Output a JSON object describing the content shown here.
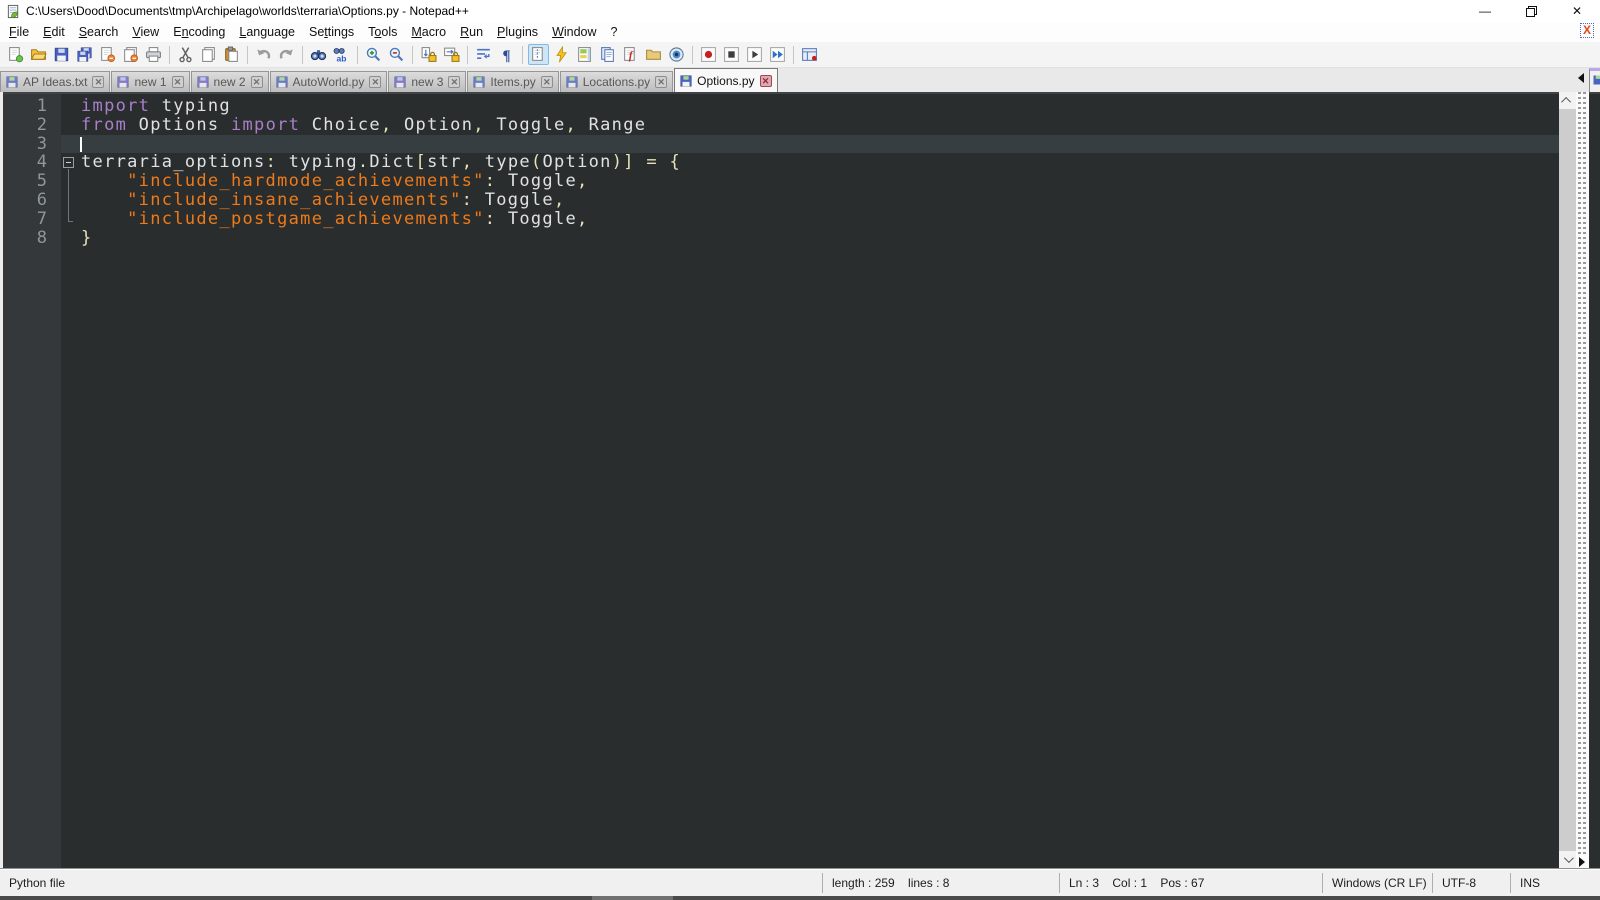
{
  "window": {
    "title": "C:\\Users\\Dood\\Documents\\tmp\\Archipelago\\worlds\\terraria\\Options.py - Notepad++",
    "controls": {
      "minimize": "—",
      "restore": "❐",
      "close": "✕"
    }
  },
  "menu": {
    "items": [
      {
        "label": "File",
        "mnemonic": 0
      },
      {
        "label": "Edit",
        "mnemonic": 0
      },
      {
        "label": "Search",
        "mnemonic": 0
      },
      {
        "label": "View",
        "mnemonic": 0
      },
      {
        "label": "Encoding",
        "mnemonic": 1
      },
      {
        "label": "Language",
        "mnemonic": 0
      },
      {
        "label": "Settings",
        "mnemonic": 2
      },
      {
        "label": "Tools",
        "mnemonic": 1
      },
      {
        "label": "Macro",
        "mnemonic": 0
      },
      {
        "label": "Run",
        "mnemonic": 0
      },
      {
        "label": "Plugins",
        "mnemonic": 0
      },
      {
        "label": "Window",
        "mnemonic": 0
      },
      {
        "label": "?",
        "mnemonic": -1
      }
    ],
    "doc_close_label": "X"
  },
  "toolbar": {
    "groups": [
      [
        "new-file",
        "open-folder",
        "save",
        "save-all",
        "close-doc",
        "close-all-docs",
        "print"
      ],
      [
        "cut",
        "copy",
        "paste"
      ],
      [
        "undo",
        "redo"
      ],
      [
        "find",
        "replace"
      ],
      [
        "zoom-in",
        "zoom-out"
      ],
      [
        "sync-vertical-scroll",
        "sync-horizontal-scroll"
      ],
      [
        "word-wrap",
        "show-all-chars"
      ],
      [
        "show-indent-guide",
        "define-language",
        "document-map",
        "document-list",
        "function-list",
        "folder-as-workspace",
        "monitoring"
      ],
      [
        "macro-record",
        "macro-stop",
        "macro-play",
        "macro-run-multiple"
      ],
      [
        "save-recorded-macro"
      ]
    ],
    "pressed": [
      "show-indent-guide"
    ]
  },
  "tabs": [
    {
      "label": "AP Ideas.txt",
      "kind": "saved",
      "active": false
    },
    {
      "label": "new 1",
      "kind": "new",
      "active": false
    },
    {
      "label": "new 2",
      "kind": "new",
      "active": false
    },
    {
      "label": "AutoWorld.py",
      "kind": "saved",
      "active": false
    },
    {
      "label": "new 3",
      "kind": "new",
      "active": false
    },
    {
      "label": "Items.py",
      "kind": "saved",
      "active": false
    },
    {
      "label": "Locations.py",
      "kind": "saved",
      "active": false
    },
    {
      "label": "Options.py",
      "kind": "saved",
      "active": true
    }
  ],
  "editor": {
    "caret_line": 3,
    "lines": [
      {
        "num": 1,
        "fold": "",
        "tokens": [
          [
            "import",
            "k"
          ],
          [
            " typing",
            "d"
          ]
        ]
      },
      {
        "num": 2,
        "fold": "",
        "tokens": [
          [
            "from",
            "k"
          ],
          [
            " Options ",
            "d"
          ],
          [
            "import",
            "k"
          ],
          [
            " Choice",
            "d"
          ],
          [
            ",",
            "o"
          ],
          [
            " Option",
            "d"
          ],
          [
            ",",
            "o"
          ],
          [
            " Toggle",
            "d"
          ],
          [
            ",",
            "o"
          ],
          [
            " Range",
            "d"
          ]
        ]
      },
      {
        "num": 3,
        "fold": "",
        "tokens": []
      },
      {
        "num": 4,
        "fold": "box",
        "tokens": [
          [
            "terraria_options",
            "d"
          ],
          [
            ":",
            "o"
          ],
          [
            " typing",
            "d"
          ],
          [
            ".",
            "o"
          ],
          [
            "Dict",
            "d"
          ],
          [
            "[",
            "o"
          ],
          [
            "str",
            "d"
          ],
          [
            ",",
            "o"
          ],
          [
            " ",
            "d"
          ],
          [
            "type",
            "d"
          ],
          [
            "(",
            "o"
          ],
          [
            "Option",
            "d"
          ],
          [
            ")",
            "o"
          ],
          [
            "]",
            "o"
          ],
          [
            " ",
            "d"
          ],
          [
            "=",
            "o"
          ],
          [
            " ",
            "d"
          ],
          [
            "{",
            "o"
          ]
        ]
      },
      {
        "num": 5,
        "fold": "line",
        "tokens": [
          [
            "    ",
            "d"
          ],
          [
            "\"include_hardmode_achievements\"",
            "s"
          ],
          [
            ":",
            "o"
          ],
          [
            " Toggle",
            "d"
          ],
          [
            ",",
            "o"
          ]
        ]
      },
      {
        "num": 6,
        "fold": "line",
        "tokens": [
          [
            "    ",
            "d"
          ],
          [
            "\"include_insane_achievements\"",
            "s"
          ],
          [
            ":",
            "o"
          ],
          [
            " Toggle",
            "d"
          ],
          [
            ",",
            "o"
          ]
        ]
      },
      {
        "num": 7,
        "fold": "corner",
        "tokens": [
          [
            "    ",
            "d"
          ],
          [
            "\"include_postgame_achievements\"",
            "s"
          ],
          [
            ":",
            "o"
          ],
          [
            " Toggle",
            "d"
          ],
          [
            ",",
            "o"
          ]
        ]
      },
      {
        "num": 8,
        "fold": "",
        "tokens": [
          [
            "}",
            "o"
          ]
        ]
      }
    ],
    "colors": {
      "keyword": "#a87fc9",
      "default": "#dfe1e3",
      "string": "#ee7a19",
      "operator": "#e8e2b7"
    }
  },
  "status": {
    "doc_type": "Python file",
    "length_info": "length : 259    lines : 8",
    "cursor_info": "Ln : 3    Col : 1    Pos : 67",
    "eol": "Windows (CR LF)",
    "encoding": "UTF-8",
    "typing_mode": "INS"
  }
}
